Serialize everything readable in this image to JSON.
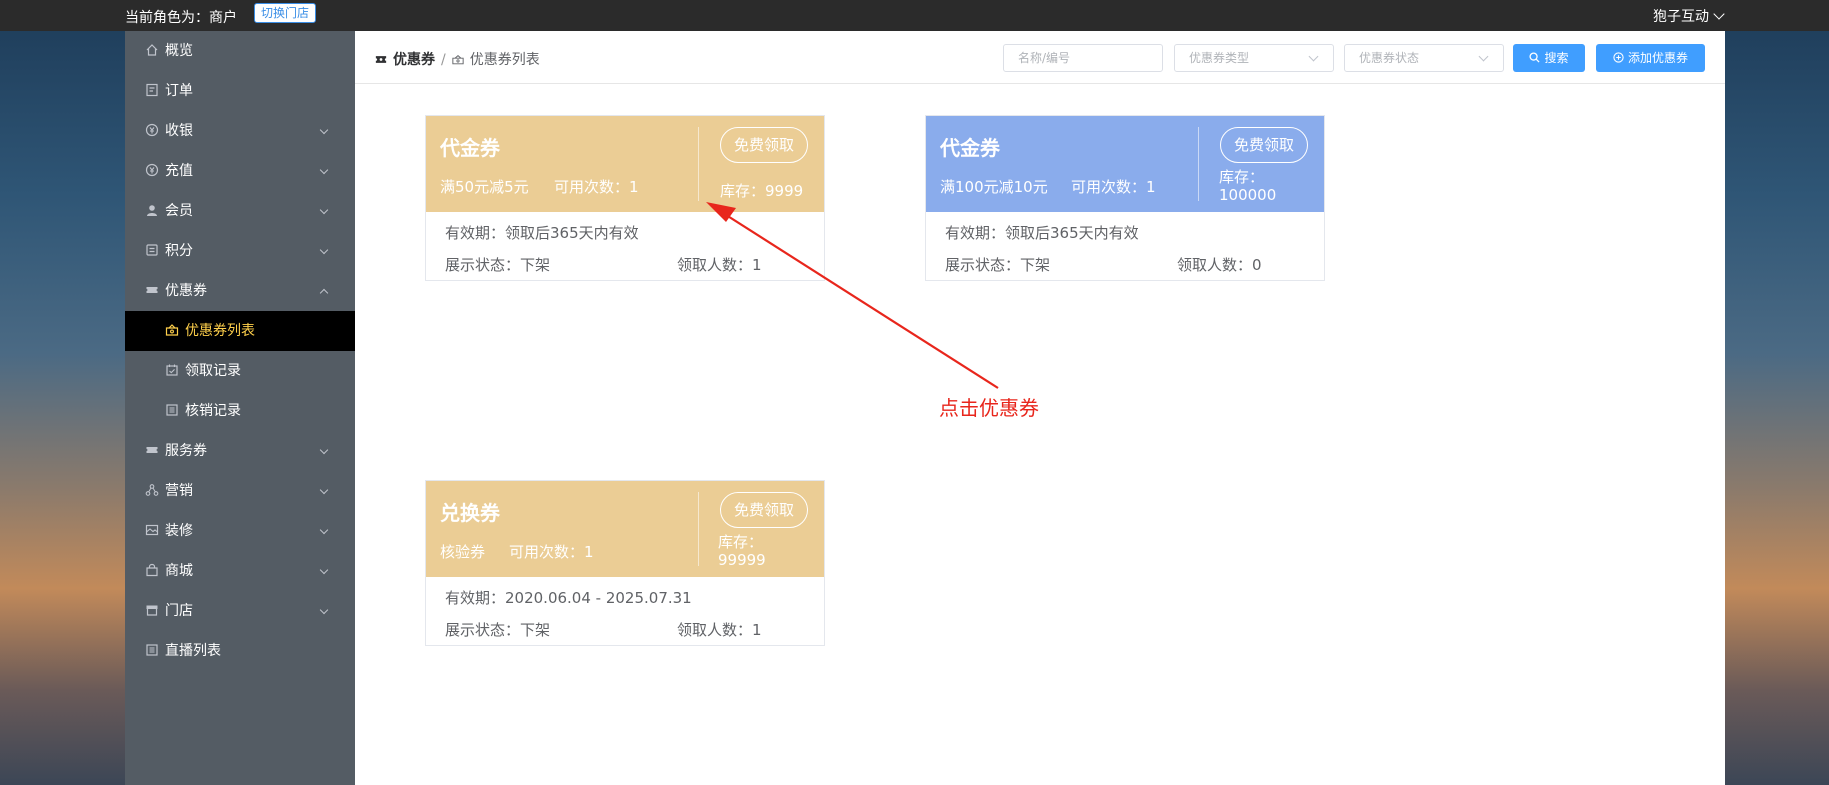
{
  "topbar": {
    "role_text": "当前角色为：商户",
    "switch_store_label": "切换门店",
    "user_name": "狍子互动"
  },
  "sidebar": {
    "items": [
      {
        "label": "概览",
        "icon": "home-icon"
      },
      {
        "label": "订单",
        "icon": "order-icon"
      },
      {
        "label": "收银",
        "icon": "cashier-icon",
        "expandable": true
      },
      {
        "label": "充值",
        "icon": "recharge-icon",
        "expandable": true
      },
      {
        "label": "会员",
        "icon": "member-icon",
        "expandable": true
      },
      {
        "label": "积分",
        "icon": "points-icon",
        "expandable": true
      },
      {
        "label": "优惠券",
        "icon": "coupon-icon",
        "expandable": true,
        "expanded": true
      },
      {
        "label": "服务券",
        "icon": "ticket-icon",
        "expandable": true
      },
      {
        "label": "营销",
        "icon": "marketing-icon",
        "expandable": true
      },
      {
        "label": "装修",
        "icon": "decorate-icon",
        "expandable": true
      },
      {
        "label": "商城",
        "icon": "mall-icon",
        "expandable": true
      },
      {
        "label": "门店",
        "icon": "store-icon",
        "expandable": true
      },
      {
        "label": "直播列表",
        "icon": "live-icon"
      }
    ],
    "coupon_sub": [
      {
        "label": "优惠券列表",
        "icon": "coupon-list-icon",
        "active": true
      },
      {
        "label": "领取记录",
        "icon": "calendar-check-icon"
      },
      {
        "label": "核销记录",
        "icon": "list-icon"
      }
    ]
  },
  "header": {
    "breadcrumb": [
      "优惠券",
      "优惠券列表"
    ],
    "search_placeholder": "名称/编号",
    "type_placeholder": "优惠券类型",
    "status_placeholder": "优惠券状态",
    "search_label": "搜索",
    "add_label": "添加优惠券"
  },
  "coupons": [
    {
      "title": "代金券",
      "rule": "满50元减5元",
      "usable": "可用次数：1",
      "button": "免费领取",
      "stock": "库存：9999",
      "validity": "有效期：领取后365天内有效",
      "display_status": "展示状态：下架",
      "claimed": "领取人数：1",
      "color": "#ebcd95"
    },
    {
      "title": "代金券",
      "rule": "满100元减10元",
      "usable": "可用次数：1",
      "button": "免费领取",
      "stock": "库存：100000",
      "validity": "有效期：领取后365天内有效",
      "display_status": "展示状态：下架",
      "claimed": "领取人数：0",
      "color": "#8aacec"
    },
    {
      "title": "兑换券",
      "rule": "核验券",
      "usable": "可用次数：1",
      "button": "免费领取",
      "stock": "库存：99999",
      "validity": "有效期：2020.06.04 - 2025.07.31",
      "display_status": "展示状态：下架",
      "claimed": "领取人数：1",
      "color": "#ebcd95"
    }
  ],
  "annotation": {
    "text": "点击优惠券",
    "color": "#e8261c"
  }
}
